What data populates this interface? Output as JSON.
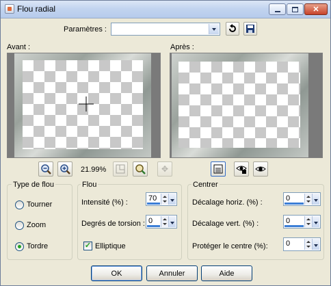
{
  "window": {
    "title": "Flou radial",
    "icons": [
      "app-icon",
      "minimize-icon",
      "maximize-icon",
      "close-icon"
    ]
  },
  "params": {
    "label": "Paramètres :",
    "value": ""
  },
  "preview": {
    "before_label": "Avant :",
    "after_label": "Après :",
    "zoom_text": "21.99%"
  },
  "groups": {
    "type": {
      "title": "Type de flou",
      "options": [
        "Tourner",
        "Zoom",
        "Tordre"
      ],
      "selected": "Tordre"
    },
    "flou": {
      "title": "Flou",
      "intensity_label": "Intensité (%) :",
      "intensity_value": "70",
      "torsion_label": "Degrés de torsion :",
      "torsion_value": "0",
      "elliptic_label": "Elliptique",
      "elliptic_checked": true
    },
    "centre": {
      "title": "Centrer",
      "horiz_label": "Décalage horiz. (%) :",
      "horiz_value": "0",
      "vert_label": "Décalage vert. (%) :",
      "vert_value": "0",
      "protect_label": "Protéger le centre (%):",
      "protect_value": "0"
    }
  },
  "buttons": {
    "ok": "OK",
    "cancel": "Annuler",
    "help": "Aide"
  },
  "colors": {
    "dialog_bg": "#ece9d8",
    "accent": "#3c7fd6",
    "radio_dot": "#21a121"
  }
}
